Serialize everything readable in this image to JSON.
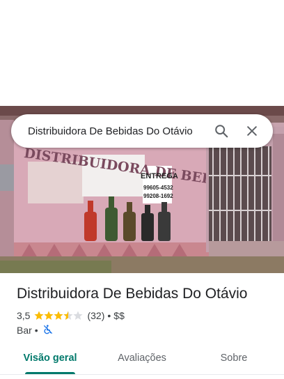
{
  "search": {
    "query": "Distribuidora De Bebidas Do Otávio",
    "search_icon": "search-icon",
    "close_icon": "close-icon"
  },
  "photo": {
    "sign_text": "DISTRIBUIDORA DE BEBIDAS",
    "sign_delivery": "ENTREGA",
    "sign_phone_1": "99605-4532",
    "sign_phone_2": "99208-1692"
  },
  "place": {
    "name": "Distribuidora De Bebidas Do Otávio",
    "rating": "3,5",
    "rating_value": 3.5,
    "rating_max": 5,
    "review_count": "(32)",
    "separator": "•",
    "price": "$$",
    "category": "Bar",
    "category_separator": "•",
    "accessibility_icon": "no-wheelchair-icon"
  },
  "tabs": [
    {
      "label": "Visão geral",
      "active": true
    },
    {
      "label": "Avaliações",
      "active": false
    },
    {
      "label": "Sobre",
      "active": false
    }
  ],
  "colors": {
    "accent": "#00796b",
    "star": "#fbbc04",
    "star_empty": "#dadce0",
    "accessibility_icon": "#1a73e8"
  }
}
